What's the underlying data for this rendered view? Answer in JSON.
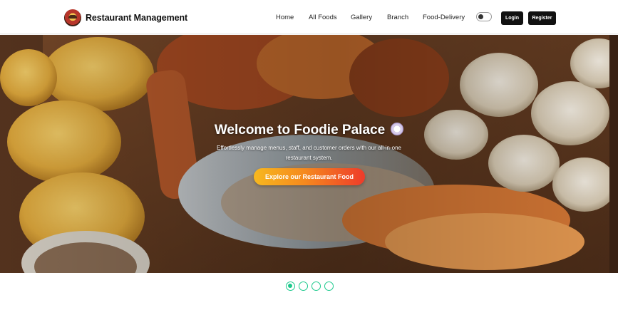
{
  "brand": {
    "name": "Restaurant Management",
    "logo_icon": "restaurant-logo-icon"
  },
  "nav": {
    "links": [
      "Home",
      "All Foods",
      "Gallery",
      "Branch",
      "Food-Delivery"
    ],
    "theme_toggle": {
      "icon": "theme-toggle-icon",
      "state": "off"
    },
    "login_label": "Login",
    "register_label": "Register"
  },
  "hero": {
    "title": "Welcome to Foodie Palace",
    "title_icon": "plate-icon",
    "subtitle": "Effortlessly manage menus, staff, and customer orders with our all-in-one restaurant system.",
    "cta_label": "Explore our Restaurant Food"
  },
  "carousel": {
    "slide_count": 4,
    "active_slide": 1
  },
  "colors": {
    "accent_green": "#1cc98c",
    "cta_start": "#f7b81f",
    "cta_end": "#ee3b2a",
    "button_dark": "#111111"
  }
}
